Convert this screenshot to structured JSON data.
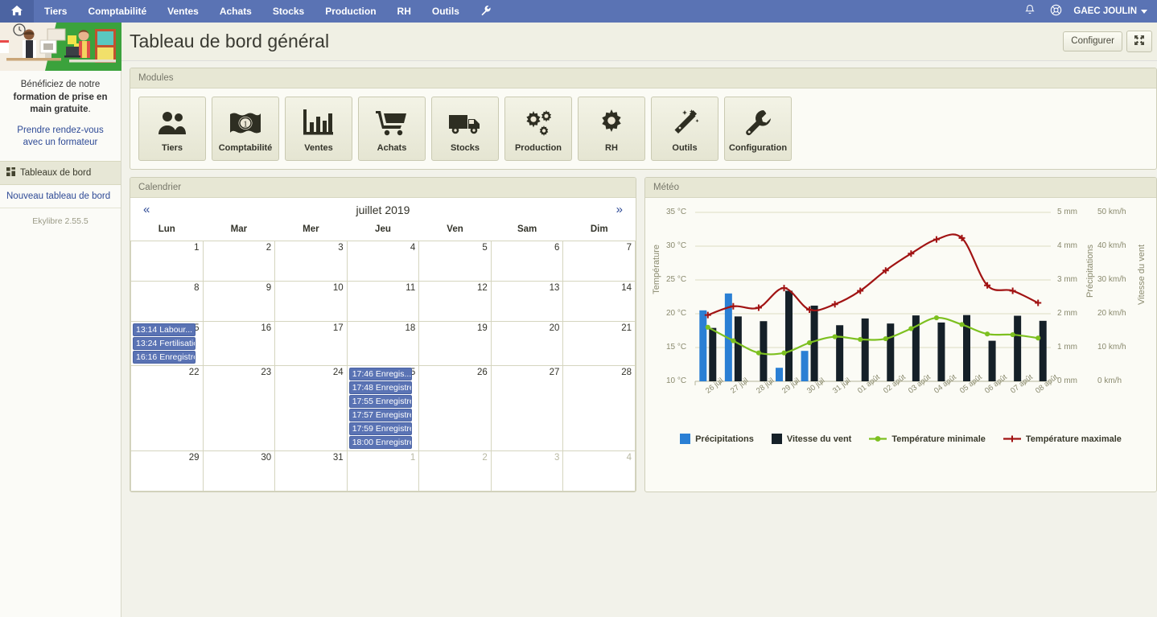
{
  "topnav": {
    "home_icon": "home-icon",
    "items": [
      "Tiers",
      "Comptabilité",
      "Ventes",
      "Achats",
      "Stocks",
      "Production",
      "RH"
    ],
    "tools_label": "Outils",
    "wrench_icon": "wrench-icon",
    "bell_icon": "bell-icon",
    "help_icon": "lifebuoy-icon",
    "user": "GAEC JOULIN"
  },
  "sidebar": {
    "promo_text_1": "Bénéficiez de notre ",
    "promo_text_bold": "formation de prise en main gratuite",
    "promo_text_2": ".",
    "promo_link": "Prendre rendez-vous avec un formateur",
    "section_title": "Tableaux de bord",
    "new_dashboard": "Nouveau tableau de bord",
    "version": "Ekylibre 2.55.5"
  },
  "header": {
    "title": "Tableau de bord général",
    "configure_label": "Configurer",
    "fullscreen_icon": "fullscreen-icon"
  },
  "modules": {
    "panel_title": "Modules",
    "tiles": [
      {
        "label": "Tiers",
        "icon": "people-icon"
      },
      {
        "label": "Comptabilité",
        "icon": "banknote-icon"
      },
      {
        "label": "Ventes",
        "icon": "bar-chart-icon"
      },
      {
        "label": "Achats",
        "icon": "shopping-cart-icon"
      },
      {
        "label": "Stocks",
        "icon": "truck-icon"
      },
      {
        "label": "Production",
        "icon": "gears-icon"
      },
      {
        "label": "RH",
        "icon": "gear-icon"
      },
      {
        "label": "Outils",
        "icon": "magic-wand-icon"
      },
      {
        "label": "Configuration",
        "icon": "wrench-icon"
      }
    ]
  },
  "calendar": {
    "panel_title": "Calendrier",
    "prev_label": "«",
    "next_label": "»",
    "month_label": "juillet 2019",
    "weekdays": [
      "Lun",
      "Mar",
      "Mer",
      "Jeu",
      "Ven",
      "Sam",
      "Dim"
    ],
    "weeks": [
      [
        {
          "day": "1"
        },
        {
          "day": "2"
        },
        {
          "day": "3"
        },
        {
          "day": "4"
        },
        {
          "day": "5"
        },
        {
          "day": "6"
        },
        {
          "day": "7"
        }
      ],
      [
        {
          "day": "8"
        },
        {
          "day": "9"
        },
        {
          "day": "10"
        },
        {
          "day": "11"
        },
        {
          "day": "12"
        },
        {
          "day": "13"
        },
        {
          "day": "14"
        }
      ],
      [
        {
          "day": "15",
          "events": [
            "13:14 Labour...",
            "13:24 Fertilisatio...",
            "16:16 Enregistre..."
          ]
        },
        {
          "day": "16"
        },
        {
          "day": "17"
        },
        {
          "day": "18"
        },
        {
          "day": "19"
        },
        {
          "day": "20"
        },
        {
          "day": "21"
        }
      ],
      [
        {
          "day": "22"
        },
        {
          "day": "23"
        },
        {
          "day": "24"
        },
        {
          "day": "25",
          "events": [
            "17:46 Enregis...",
            "17:48 Enregistre...",
            "17:55 Enregistre...",
            "17:57 Enregistre...",
            "17:59 Enregistre...",
            "18:00 Enregistre..."
          ]
        },
        {
          "day": "26",
          "today": true
        },
        {
          "day": "27"
        },
        {
          "day": "28"
        }
      ],
      [
        {
          "day": "29"
        },
        {
          "day": "30"
        },
        {
          "day": "31"
        },
        {
          "day": "1",
          "other": true
        },
        {
          "day": "2",
          "other": true
        },
        {
          "day": "3",
          "other": true
        },
        {
          "day": "4",
          "other": true
        }
      ]
    ]
  },
  "meteo": {
    "panel_title": "Météo"
  },
  "chart_data": {
    "type": "bar",
    "title": "Météo",
    "categories": [
      "26 juil",
      "27 juil",
      "28 juil",
      "29 juil",
      "30 juil",
      "31 juil",
      "01 août",
      "02 août",
      "03 août",
      "04 août",
      "05 août",
      "06 août",
      "07 août",
      "08 août"
    ],
    "axes": {
      "temperature": {
        "label": "Température",
        "unit": "°C",
        "min": 10,
        "max": 35,
        "step": 5,
        "ticks": [
          "10 °C",
          "15 °C",
          "20 °C",
          "25 °C",
          "30 °C",
          "35 °C"
        ]
      },
      "precipitation": {
        "label": "Précipitations",
        "unit": "mm",
        "min": 0,
        "max": 5,
        "step": 1,
        "ticks": [
          "0 mm",
          "1 mm",
          "2 mm",
          "3 mm",
          "4 mm",
          "5 mm"
        ]
      },
      "wind": {
        "label": "Vitesse du vent",
        "unit": "km/h",
        "min": 0,
        "max": 50,
        "step": 10,
        "ticks": [
          "0 km/h",
          "10 km/h",
          "20 km/h",
          "30 km/h",
          "40 km/h",
          "50 km/h"
        ]
      }
    },
    "grid": true,
    "legend_position": "bottom",
    "series": [
      {
        "name": "Précipitations",
        "type": "bar",
        "axis": "precipitation",
        "unit": "mm",
        "color": "#2a7fd4",
        "values": [
          2.1,
          2.6,
          0,
          0.4,
          0.9,
          0,
          0,
          0,
          0,
          0,
          0,
          0,
          0,
          0
        ]
      },
      {
        "name": "Vitesse du vent",
        "type": "bar",
        "axis": "wind",
        "unit": "km/h",
        "color": "#152028",
        "values": [
          15.8,
          19.2,
          17.8,
          26.8,
          22.4,
          16.6,
          18.6,
          17.1,
          19.5,
          17.4,
          19.6,
          12.0,
          19.4,
          17.9
        ]
      },
      {
        "name": "Température minimale",
        "type": "line",
        "axis": "temperature",
        "unit": "°C",
        "color": "#7dc020",
        "values": [
          18.0,
          16.0,
          14.2,
          14.2,
          15.7,
          16.6,
          16.2,
          16.3,
          17.8,
          19.4,
          18.4,
          17.0,
          16.9,
          16.4
        ]
      },
      {
        "name": "Température maximale",
        "type": "line",
        "axis": "temperature",
        "unit": "°C",
        "color": "#a11313",
        "values": [
          19.8,
          21.1,
          20.9,
          23.8,
          20.6,
          21.4,
          23.4,
          26.4,
          28.9,
          31.0,
          31.2,
          24.2,
          23.4,
          21.6
        ]
      }
    ]
  }
}
